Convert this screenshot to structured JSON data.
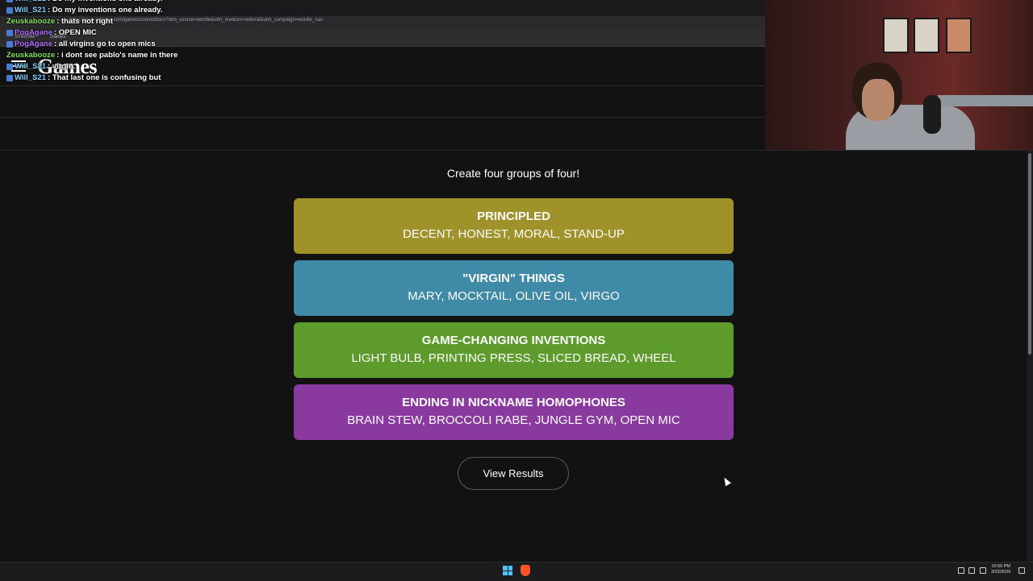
{
  "browser": {
    "address": "https://www.nytimes.com/games/connections?utm_source=wordle&utm_medium=referral&utm_campaign=wordle_nav",
    "bookmarks": [
      "STREAM",
      "Games"
    ]
  },
  "site": {
    "logo_text": "Games"
  },
  "chat": [
    {
      "user": "Will_S21",
      "message": "Do my inventions one already.",
      "color": "#7fd3ff"
    },
    {
      "user": "Zeuskabooze",
      "message": "thats not right",
      "color": "#7fe35a"
    },
    {
      "user": "PogAgane",
      "message": "OPEN MIC",
      "color": "#b06cff"
    },
    {
      "user": "PogAgane",
      "message": "all virgins go to open mics",
      "color": "#b06cff"
    },
    {
      "user": "Zeuskabooze",
      "message": "i dont see pablo's name in there",
      "color": "#7fe35a"
    },
    {
      "user": "Will_S21",
      "message": "virgin.",
      "color": "#7fd3ff"
    },
    {
      "user": "Will_S21",
      "message": "That last one is confusing but",
      "color": "#7fd3ff"
    }
  ],
  "game": {
    "instructions": "Create four groups of four!",
    "groups": [
      {
        "title": "PRINCIPLED",
        "members": "DECENT, HONEST, MORAL, STAND-UP",
        "color": "#a0922a"
      },
      {
        "title": "\"VIRGIN\" THINGS",
        "members": "MARY, MOCKTAIL, OLIVE OIL, VIRGO",
        "color": "#3f8aa6"
      },
      {
        "title": "GAME-CHANGING INVENTIONS",
        "members": "LIGHT BULB, PRINTING PRESS, SLICED BREAD, WHEEL",
        "color": "#5c9b2c"
      },
      {
        "title": "ENDING IN NICKNAME HOMOPHONES",
        "members": "BRAIN STEW, BROCCOLI RABE, JUNGLE GYM, OPEN MIC",
        "color": "#8a3a9e"
      }
    ],
    "view_results_label": "View Results"
  },
  "taskbar": {
    "time": "10:56 PM",
    "date": "3/23/2026"
  }
}
